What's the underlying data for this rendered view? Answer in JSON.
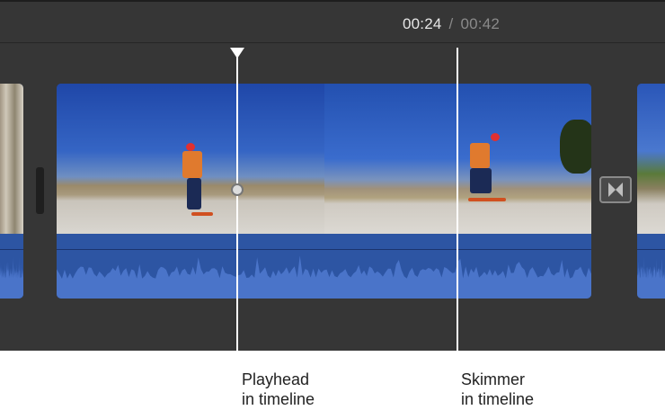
{
  "timecode": {
    "current": "00:24",
    "separator": "/",
    "total": "00:42"
  },
  "callouts": {
    "playhead": [
      "Playhead",
      "in timeline"
    ],
    "skimmer": [
      "Skimmer",
      "in timeline"
    ]
  },
  "colors": {
    "background": "#363636",
    "audio": "#2d55a3",
    "waveform": "#4a74c9"
  }
}
